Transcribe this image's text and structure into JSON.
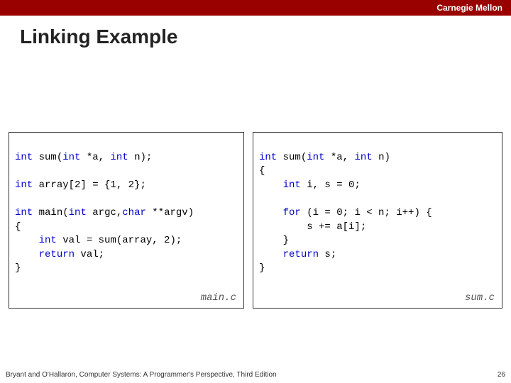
{
  "header": {
    "org": "Carnegie Mellon"
  },
  "title": "Linking Example",
  "code_left": {
    "l1a": "int",
    "l1b": " sum(",
    "l1c": "int",
    "l1d": " *a, ",
    "l1e": "int",
    "l1f": " n);",
    "l2a": "int",
    "l2b": " array[2] = {1, 2};",
    "l3a": "int",
    "l3b": " main(",
    "l3c": "int",
    "l3d": " argc,",
    "l3e": "char",
    "l3f": " **argv)",
    "l4": "{",
    "l5a": "    ",
    "l5b": "int",
    "l5c": " val = sum(array, 2);",
    "l6a": "    ",
    "l6b": "return",
    "l6c": " val;",
    "l7": "}",
    "filename": "main.c"
  },
  "code_right": {
    "l1a": "int",
    "l1b": " sum(",
    "l1c": "int",
    "l1d": " *a, ",
    "l1e": "int",
    "l1f": " n)",
    "l2": "{",
    "l3a": "    ",
    "l3b": "int",
    "l3c": " i, s = 0;",
    "l4a": "    ",
    "l4b": "for",
    "l4c": " (i = 0; i < n; i++) {",
    "l5": "        s += a[i];",
    "l6": "    }",
    "l7a": "    ",
    "l7b": "return",
    "l7c": " s;",
    "l8": "}",
    "filename": "sum.c"
  },
  "footer": {
    "citation": "Bryant and O'Hallaron, Computer Systems: A Programmer's Perspective, Third Edition",
    "page": "26"
  }
}
